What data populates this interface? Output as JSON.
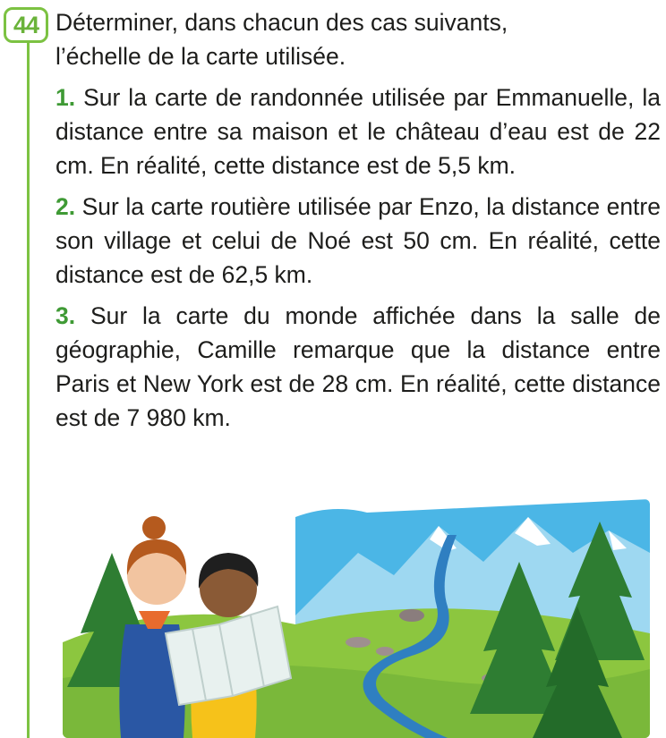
{
  "exercise": {
    "number": "44",
    "instruction_line1": "Déterminer, dans chacun des cas suivants,",
    "instruction_line2": "l’échelle de la carte utilisée.",
    "accent_color": "#7cc242",
    "items": [
      {
        "label": "1.",
        "text": "Sur la carte de randonnée utilisée par Emmanuelle, la distance entre sa maison et le château d’eau est de 22 cm. En réalité, cette distance est de 5,5 km."
      },
      {
        "label": "2.",
        "text": "Sur la carte routière utilisée par Enzo, la distance entre son village et celui de Noé est 50 cm. En réalité, cette distance est de 62,5 km."
      },
      {
        "label": "3.",
        "text": "Sur la carte du monde affichée dans la salle de géographie, Camille remarque que la distance entre Paris et New York est de 28 cm. En réalité, cette distance est de 7 980 km."
      }
    ]
  },
  "illustration": {
    "icon": "hikers-reading-map-illustration",
    "sky_color": "#4bb6e6",
    "grass_color": "#8cc63f",
    "tree_color": "#2e7d32"
  }
}
